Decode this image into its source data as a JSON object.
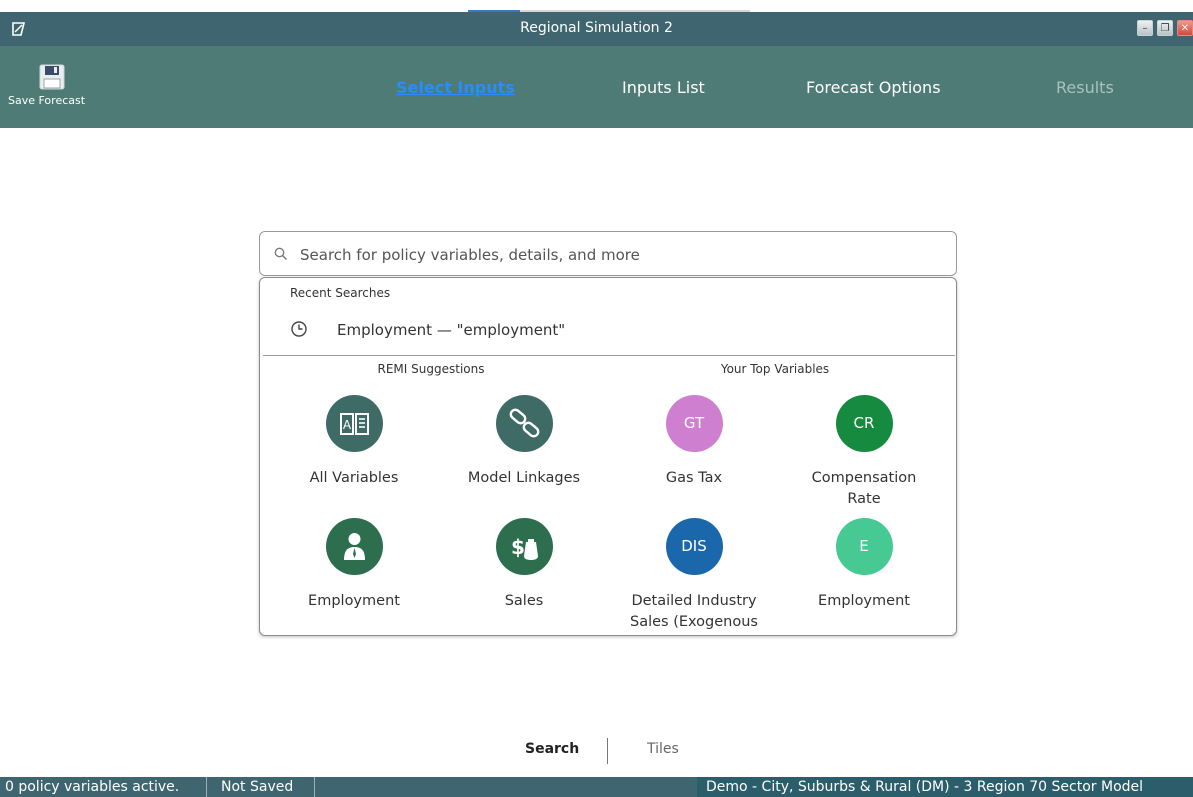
{
  "window": {
    "title": "Regional Simulation 2"
  },
  "toolbar": {
    "save_label": "Save Forecast",
    "nav": [
      {
        "label": "Select Inputs",
        "state": "active"
      },
      {
        "label": "Inputs List",
        "state": "normal"
      },
      {
        "label": "Forecast Options",
        "state": "normal"
      },
      {
        "label": "Results",
        "state": "disabled"
      }
    ]
  },
  "search": {
    "placeholder": "Search for policy variables, details, and more",
    "value": ""
  },
  "dropdown": {
    "recent_heading": "Recent Searches",
    "recent_items": [
      {
        "text": "Employment — \"employment\"",
        "icon": "clock-icon"
      }
    ],
    "suggestions_heading": "REMI Suggestions",
    "top_heading": "Your Top Variables",
    "suggestions": [
      {
        "label": "All Variables",
        "icon": "book-icon",
        "color": "#3e6b66"
      },
      {
        "label": "Model Linkages",
        "icon": "link-icon",
        "color": "#3e6b66"
      },
      {
        "label": "Employment",
        "icon": "employee-icon",
        "color": "#2d6e4f"
      },
      {
        "label": "Sales",
        "icon": "money-bag-icon",
        "color": "#2d6e4f"
      }
    ],
    "top_variables": [
      {
        "abbr": "GT",
        "label": "Gas Tax",
        "color": "#cf7fd0"
      },
      {
        "abbr": "CR",
        "label": "Compensation Rate",
        "color": "#168a3f"
      },
      {
        "abbr": "DIS",
        "label": "Detailed Industry Sales (Exogenous",
        "color": "#1a68ab"
      },
      {
        "abbr": "E",
        "label": "Employment",
        "color": "#46c992"
      }
    ]
  },
  "bottom_tabs": [
    {
      "label": "Search",
      "active": true
    },
    {
      "label": "Tiles",
      "active": false
    }
  ],
  "status": {
    "active_vars": "0 policy variables active.",
    "saved": "Not Saved",
    "model": "Demo - City, Suburbs & Rural (DM) -  3 Region 70 Sector Model"
  }
}
